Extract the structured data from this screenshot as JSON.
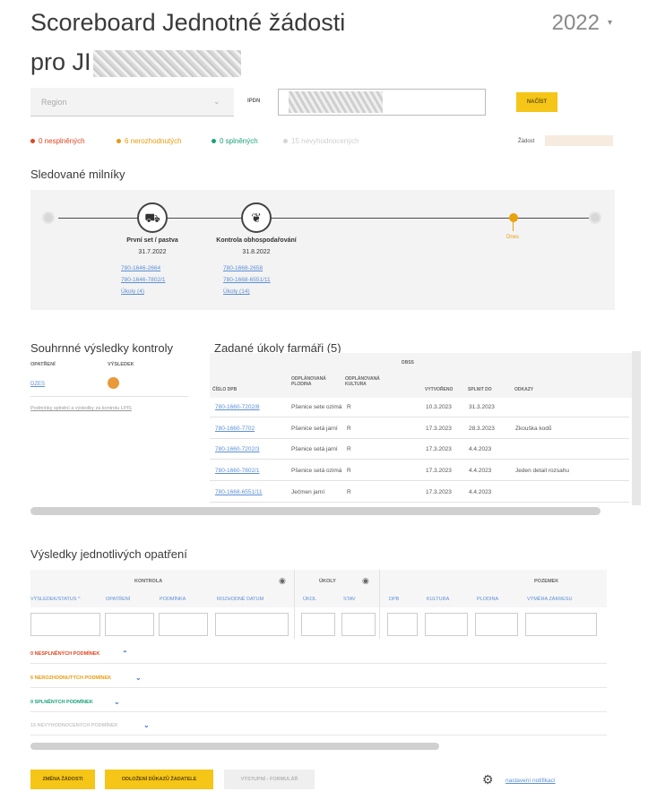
{
  "header": {
    "title_line1": "Scoreboard Jednotné žádosti",
    "title_line2": "pro JI",
    "year": "2022"
  },
  "filters": {
    "region_placeholder": "Region",
    "ipdn_label": "IPDN",
    "load_button": "NAČÍST",
    "zadost_label": "Žádost"
  },
  "status": {
    "red": "0 nesplněných",
    "orange": "6 nerozhodnutých",
    "green": "0 splněných",
    "grey": "15 nevyhodnocených"
  },
  "milestones": {
    "title": "Sledované milníky",
    "today_label": "Dnes",
    "items": [
      {
        "name": "První set / pastva",
        "date": "31.7.2022",
        "links": [
          "780-1646-2664",
          "780-1646-7802/1",
          "Úkoly (4)"
        ]
      },
      {
        "name": "Kontrola obhospodařování",
        "date": "31.8.2022",
        "links": [
          "780-1668-2658",
          "780-1668-6551/11",
          "Úkoly (14)"
        ]
      }
    ]
  },
  "summary": {
    "title": "Souhrnné výsledky kontroly",
    "col_opatreni": "OPATŘENÍ",
    "col_vysledek": "VÝSLEDEK",
    "row_label": "DZES",
    "note": "Podmínky splnění a výsledky za kontrolu LPIS"
  },
  "tasks": {
    "title": "Zadané úkoly farmáři (5)",
    "group_header": "DBSS",
    "headers": [
      "ČÍSLO DPB",
      "ODPLÁNOVANÁ PLODINA",
      "ODPLÁNOVANÁ KULTURA",
      "VYTVOŘENO",
      "SPLNIT DO",
      "ODKAZY"
    ],
    "rows": [
      [
        "780-1660-7202/8",
        "Pšenice sete ozimá",
        "R",
        "10.3.2023",
        "31.3.2023",
        ""
      ],
      [
        "780-1660-7702",
        "Pšenice setá jarní",
        "R",
        "17.3.2023",
        "28.3.2023",
        "Zkouška kodů"
      ],
      [
        "780-1660-7202/3",
        "Pšenice setá jarní",
        "R",
        "17.3.2023",
        "4.4.2023",
        ""
      ],
      [
        "780-1660-7802/1",
        "Pšenice setá ozimá",
        "R",
        "17.3.2023",
        "4.4.2023",
        "Jeden detail rozsahu"
      ],
      [
        "780-1668-6551/11",
        "Ječmen jarní",
        "R",
        "17.3.2023",
        "4.4.2023",
        ""
      ]
    ]
  },
  "results": {
    "title": "Výsledky jednotlivých opatření",
    "group_kontrola": "KONTROLA",
    "group_ukoly": "ÚKOLY",
    "group_pozemek": "POZEMEK",
    "columns": [
      "VÝSLEDEK/STATUS",
      "OPATŘENÍ",
      "PODMÍNKA",
      "ROZHODNÉ DATUM",
      "ÚKOL",
      "STAV",
      "DPB",
      "KULTURA",
      "PLODINA",
      "VÝMĚRA ZÁKRESU"
    ],
    "categories": [
      {
        "label": "0 NESPLNĚNÝCH PODMÍNEK",
        "color": "#e0451f",
        "caret": "^"
      },
      {
        "label": "6 NEROZHODNUTÝCH PODMÍNEK",
        "color": "#e89a0c",
        "caret": "v"
      },
      {
        "label": "0 SPLNĚNÝCH PODMÍNEK",
        "color": "#1aa179",
        "caret": "v"
      },
      {
        "label": "15 NEVYHODNOCENÝCH PODMÍNEK",
        "color": "#c8c8c8",
        "caret": "v"
      }
    ]
  },
  "footer": {
    "btn_zmena": "ZMĚNA ŽÁDOSTI",
    "btn_dukazy": "ODLOŽENÍ DŮKAZŮ ŽADATELE",
    "btn_export": "VÝSTUPNÍ - FORMULÁŘ",
    "notif_link": "nastavení notifikací"
  },
  "colors": {
    "accent_yellow": "#f5c518",
    "link_blue": "#5c8fd6",
    "red": "#e0451f",
    "orange": "#e89a0c",
    "green": "#1aa179"
  }
}
